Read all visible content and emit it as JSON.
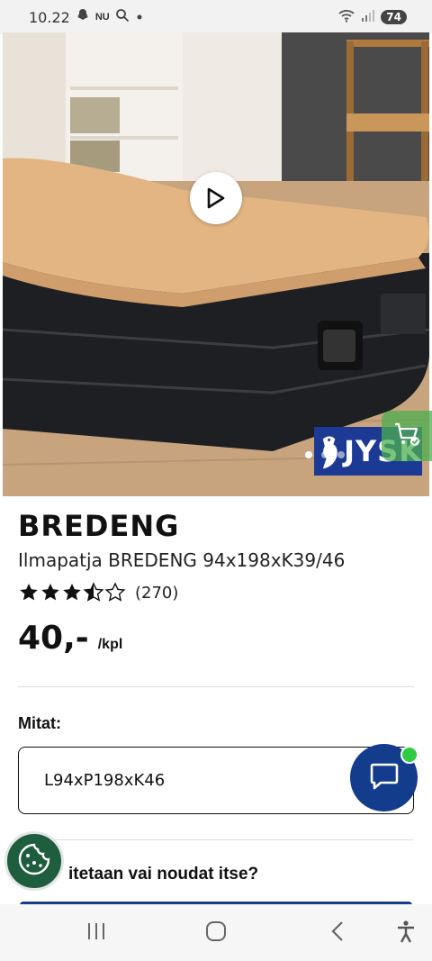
{
  "status_bar": {
    "time": "10.22",
    "carrier_tag": "NU",
    "battery": "74",
    "icons": [
      "snapchat-icon",
      "search-icon",
      "dot-icon",
      "wifi-icon",
      "signal-icon"
    ]
  },
  "hero": {
    "logo_text": "JYSK",
    "play_icon": "play-icon",
    "cart_icon": "cart-check-icon",
    "slide_count": 3,
    "active_slide": 1
  },
  "product": {
    "brand": "BREDENG",
    "subtitle": "Ilmapatja BREDENG 94x198xK39/46",
    "rating_value": 3.5,
    "rating_max": 5,
    "rating_count": "(270)",
    "price": "40,-",
    "price_unit": "/kpl"
  },
  "options": {
    "size_label": "Mitat:",
    "size_value": "L94xP198xK46"
  },
  "delivery": {
    "question": "itetaan vai noudat itse?"
  },
  "floating": {
    "chat_icon": "chat-bubble-icon",
    "cookie_icon": "cookie-icon"
  },
  "nav": {
    "icons": [
      "recent-apps-icon",
      "home-icon",
      "back-icon",
      "accessibility-icon"
    ]
  },
  "colors": {
    "brand_blue": "#143c8c",
    "cookie_green": "#1e5e3f",
    "online_green": "#2ecc40"
  }
}
